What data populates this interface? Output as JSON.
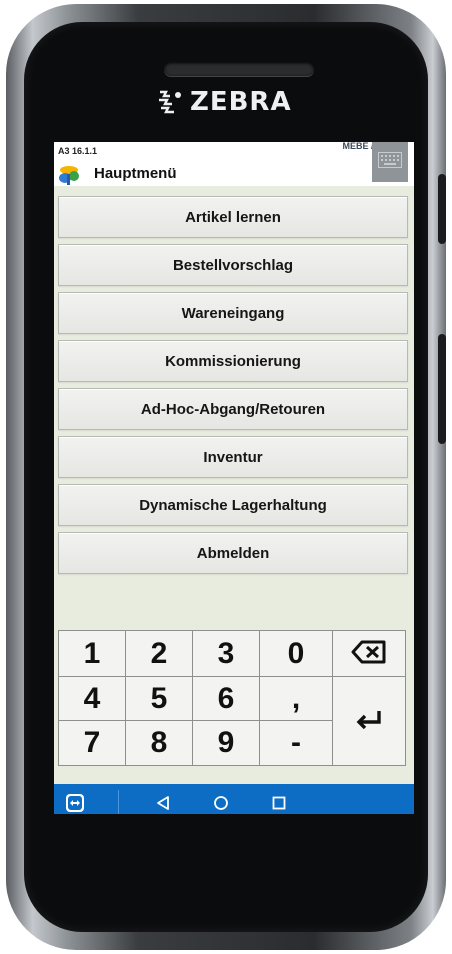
{
  "device": {
    "brand": "ZEBRA",
    "brand_logo_icon": "zebra-logo-icon"
  },
  "status": {
    "version": "A3 16.1.1",
    "user": "MEBE / MEYER",
    "keyboard_icon": "keyboard-icon"
  },
  "header": {
    "title": "Hauptmenü",
    "app_icon": "app-logo-icon"
  },
  "menu": {
    "items": [
      {
        "label": "Artikel lernen"
      },
      {
        "label": "Bestellvorschlag"
      },
      {
        "label": "Wareneingang"
      },
      {
        "label": "Kommissionierung"
      },
      {
        "label": "Ad-Hoc-Abgang/Retouren"
      },
      {
        "label": "Inventur"
      },
      {
        "label": "Dynamische Lagerhaltung"
      },
      {
        "label": "Abmelden"
      }
    ]
  },
  "keypad": {
    "keys": [
      "1",
      "2",
      "3",
      "0",
      "4",
      "5",
      "6",
      ",",
      "7",
      "8",
      "9",
      "-"
    ],
    "backspace_icon": "backspace-icon",
    "enter_icon": "enter-icon"
  },
  "navbar": {
    "remote_icon": "teamviewer-icon",
    "back_icon": "back-icon",
    "home_icon": "home-icon",
    "recents_icon": "recents-icon",
    "color": "#0d6cc4"
  }
}
